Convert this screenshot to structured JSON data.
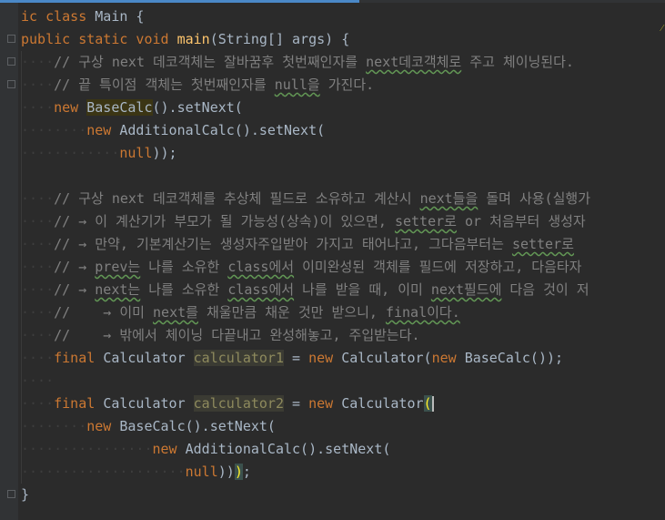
{
  "editor": {
    "lines": [
      {
        "indent": "",
        "parts": [
          [
            "kw",
            "ic class "
          ],
          [
            "pl",
            "Main {"
          ]
        ]
      },
      {
        "indent": "",
        "parts": [
          [
            "kw",
            "public static void "
          ],
          [
            "fn",
            "main"
          ],
          [
            "pl",
            "(String[] args) {"
          ]
        ]
      },
      {
        "indent": "····",
        "parts": [
          [
            "cm",
            "// 구상 next 데코객체는 잘바꿈후 첫번째인자를 "
          ],
          [
            "cmu",
            "next데코객체로"
          ],
          [
            "cm",
            " 주고 체이닝된다."
          ]
        ]
      },
      {
        "indent": "····",
        "parts": [
          [
            "cm",
            "// 끝 특이점 객체는 첫번째인자를 "
          ],
          [
            "cmu",
            "null을"
          ],
          [
            "cm",
            " 가진다."
          ]
        ]
      },
      {
        "indent": "····",
        "parts": [
          [
            "kw",
            "new "
          ],
          [
            "warn",
            "BaseCalc"
          ],
          [
            "pl",
            "().setNext("
          ]
        ]
      },
      {
        "indent": "········",
        "parts": [
          [
            "kw",
            "new "
          ],
          [
            "pl",
            "AdditionalCalc().setNext("
          ]
        ]
      },
      {
        "indent": "············",
        "parts": [
          [
            "kw",
            "null"
          ],
          [
            "pl",
            "));"
          ]
        ]
      },
      {
        "indent": "",
        "parts": []
      },
      {
        "indent": "····",
        "parts": [
          [
            "cm",
            "// 구상 next 데코객체를 추상체 필드로 소유하고 계산시 "
          ],
          [
            "cmu",
            "next들을"
          ],
          [
            "cm",
            " 돌며 사용(실행가"
          ]
        ]
      },
      {
        "indent": "····",
        "parts": [
          [
            "cm",
            "// → 이 계산기가 부모가 될 가능성(상속)이 있으면, "
          ],
          [
            "cmu",
            "setter로"
          ],
          [
            "cm",
            " or 처음부터 생성자"
          ]
        ]
      },
      {
        "indent": "····",
        "parts": [
          [
            "cm",
            "// → 만약, 기본계산기는 생성자주입받아 가지고 태어나고, 그다음부터는 "
          ],
          [
            "cmu",
            "setter로"
          ]
        ]
      },
      {
        "indent": "····",
        "parts": [
          [
            "cm",
            "// → "
          ],
          [
            "cmu",
            "prev는"
          ],
          [
            "cm",
            " 나를 소유한 "
          ],
          [
            "cmu",
            "class에서"
          ],
          [
            "cm",
            " 이미완성된 객체를 필드에 저장하고, 다음타자"
          ]
        ]
      },
      {
        "indent": "····",
        "parts": [
          [
            "cm",
            "// → "
          ],
          [
            "cmu",
            "next는"
          ],
          [
            "cm",
            " 나를 소유한 "
          ],
          [
            "cmu",
            "class에서"
          ],
          [
            "cm",
            " 나를 받을 때, 이미 "
          ],
          [
            "cmu",
            "next필드에"
          ],
          [
            "cm",
            " 다음 것이 저"
          ]
        ]
      },
      {
        "indent": "····",
        "parts": [
          [
            "cm",
            "//    → 이미 "
          ],
          [
            "cmu",
            "next를"
          ],
          [
            "cm",
            " 채울만큼 채운 것만 받으니, "
          ],
          [
            "cmu",
            "final이다."
          ]
        ]
      },
      {
        "indent": "····",
        "parts": [
          [
            "cm",
            "//    → 밖에서 체이닝 다끝내고 완성해놓고, 주입받는다."
          ]
        ]
      },
      {
        "indent": "····",
        "parts": [
          [
            "kw",
            "final "
          ],
          [
            "pl",
            "Calculator "
          ],
          [
            "vr",
            "calculator1"
          ],
          [
            "pl",
            " = "
          ],
          [
            "kw",
            "new "
          ],
          [
            "pl",
            "Calculator("
          ],
          [
            "kw",
            "new "
          ],
          [
            "pl",
            "BaseCalc());"
          ]
        ]
      },
      {
        "indent": "····",
        "parts": []
      },
      {
        "indent": "····",
        "parts": [
          [
            "kw",
            "final "
          ],
          [
            "pl",
            "Calculator "
          ],
          [
            "vr",
            "calculator2"
          ],
          [
            "pl",
            " = "
          ],
          [
            "kw",
            "new "
          ],
          [
            "pl",
            "Calculator"
          ],
          [
            "hl",
            "("
          ],
          [
            "caret",
            ""
          ]
        ]
      },
      {
        "indent": "········",
        "parts": [
          [
            "kw",
            "new "
          ],
          [
            "pl",
            "BaseCalc().setNext("
          ]
        ]
      },
      {
        "indent": "················",
        "parts": [
          [
            "kw",
            "new "
          ],
          [
            "pl",
            "AdditionalCalc().setNext("
          ]
        ]
      },
      {
        "indent": "····················",
        "parts": [
          [
            "kw",
            "null"
          ],
          [
            "pl",
            "))"
          ],
          [
            "hl",
            ")"
          ],
          [
            "pl",
            ";"
          ]
        ]
      },
      {
        "indent": "",
        "parts": [
          [
            "pl",
            "}"
          ]
        ]
      }
    ]
  }
}
